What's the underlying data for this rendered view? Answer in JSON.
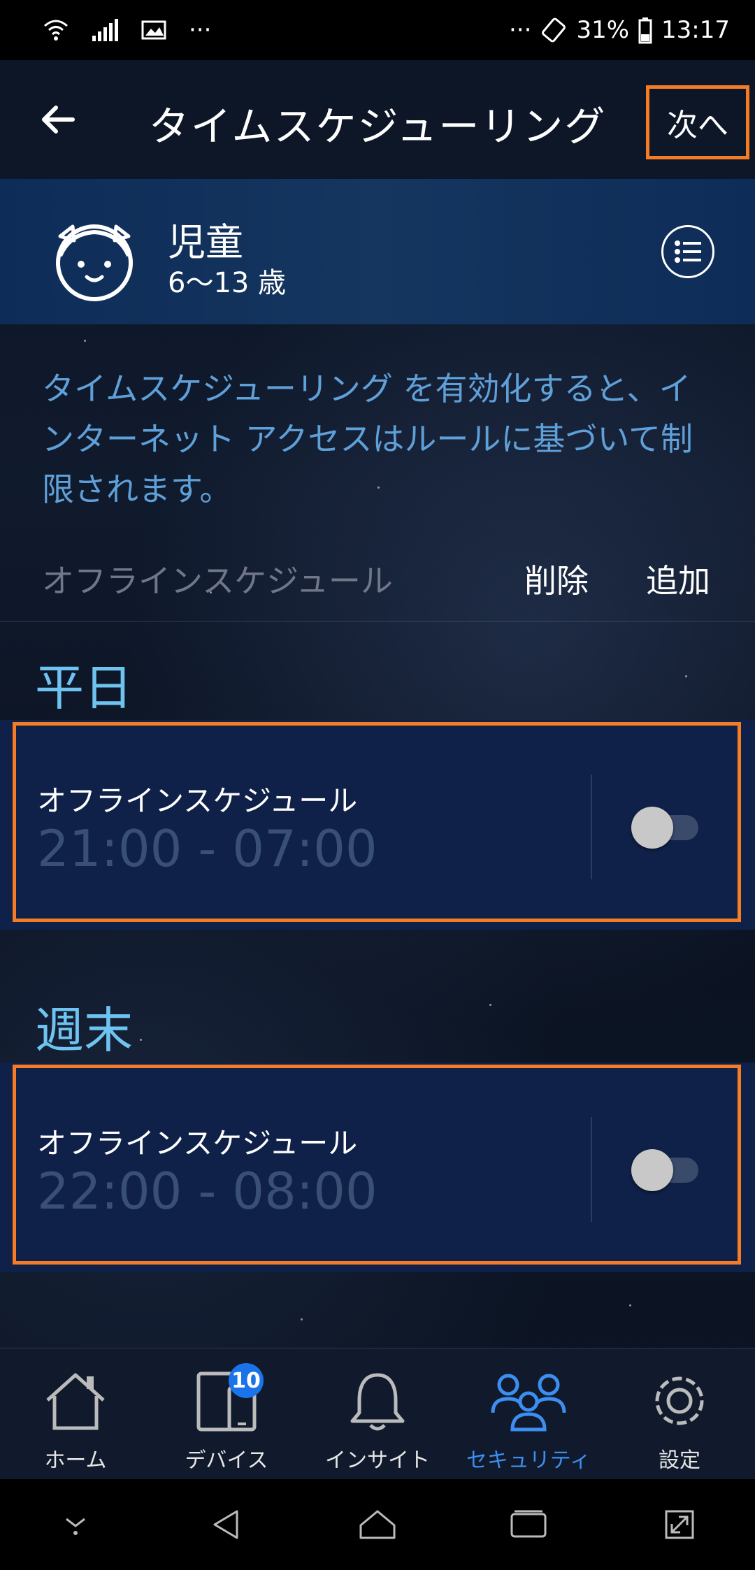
{
  "status_bar": {
    "overflow_left": "···",
    "overflow_right": "···",
    "battery": "31%",
    "time": "13:17",
    "icons": [
      "wifi-icon",
      "signal-icon",
      "image-icon",
      "rotate-icon",
      "battery-icon"
    ]
  },
  "app_bar": {
    "title": "タイムスケジューリング",
    "next_label": "次へ"
  },
  "profile": {
    "name": "児童",
    "age": "6〜13 歳"
  },
  "description": "タイムスケジューリング を有効化すると、インターネット アクセスはルールに基づいて制限されます。",
  "schedule_header": {
    "label": "オフラインスケジュール",
    "delete_label": "削除",
    "add_label": "追加"
  },
  "sections": [
    {
      "title": "平日",
      "card": {
        "label": "オフラインスケジュール",
        "time": "21:00 - 07:00",
        "enabled": false
      }
    },
    {
      "title": "週末",
      "card": {
        "label": "オフラインスケジュール",
        "time": "22:00 - 08:00",
        "enabled": false
      }
    }
  ],
  "bottom_nav": [
    {
      "label": "ホーム",
      "icon": "home-icon"
    },
    {
      "label": "デバイス",
      "icon": "devices-icon",
      "badge": "10"
    },
    {
      "label": "インサイト",
      "icon": "bell-icon"
    },
    {
      "label": "セキュリティ",
      "icon": "family-icon",
      "active": true
    },
    {
      "label": "設定",
      "icon": "gear-icon"
    }
  ],
  "colors": {
    "accent_orange": "#f47c25",
    "link_blue": "#5fa0d8",
    "section_blue": "#6ec3f0",
    "active_blue": "#3c8ff0",
    "card_bg": "#0f2149"
  }
}
